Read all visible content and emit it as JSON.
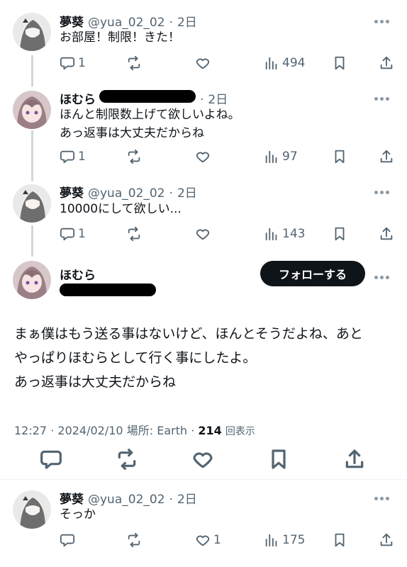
{
  "tweets": [
    {
      "name": "夢葵",
      "handle": "@yua_02_02",
      "sep": "·",
      "time": "2日",
      "lines": [
        "お部屋！制限！きた！"
      ],
      "reply_count": "1",
      "like_count": "",
      "view_count": "494"
    },
    {
      "name": "ほむら",
      "handle": "",
      "sep": "·",
      "time": "2日",
      "lines": [
        "ほんと制限数上げて欲しいよね。",
        "あっ返事は大丈夫だからね"
      ],
      "reply_count": "1",
      "like_count": "",
      "view_count": "97"
    },
    {
      "name": "夢葵",
      "handle": "@yua_02_02",
      "sep": "·",
      "time": "2日",
      "lines": [
        "10000にして欲しい..."
      ],
      "reply_count": "1",
      "like_count": "",
      "view_count": "143"
    }
  ],
  "main_tweet": {
    "name": "ほむら",
    "follow_label": "フォローする",
    "lines": [
      "まぁ僕はもう送る事はないけど、ほんとそうだよね、あと",
      "やっぱりほむらとして行く事にしたよ。",
      "あっ返事は大丈夫だからね"
    ],
    "time": "12:27",
    "date": "2024/02/10",
    "location_label": "場所:",
    "location": "Earth",
    "views": "214",
    "views_label": "回表示",
    "dot": "·"
  },
  "reply": {
    "name": "夢葵",
    "handle": "@yua_02_02",
    "sep": "·",
    "time": "2日",
    "lines": [
      "そっか"
    ],
    "reply_count": "",
    "like_count": "1",
    "view_count": "175"
  },
  "icons": {
    "reply": "reply-icon",
    "retweet": "retweet-icon",
    "like": "heart-icon",
    "views": "views-icon",
    "bookmark": "bookmark-icon",
    "share": "share-icon",
    "more": "more-icon"
  },
  "colors": {
    "text": "#0f1419",
    "secondary": "#536471",
    "thread_line": "#cfd9de",
    "follow_bg": "#0f1419"
  }
}
